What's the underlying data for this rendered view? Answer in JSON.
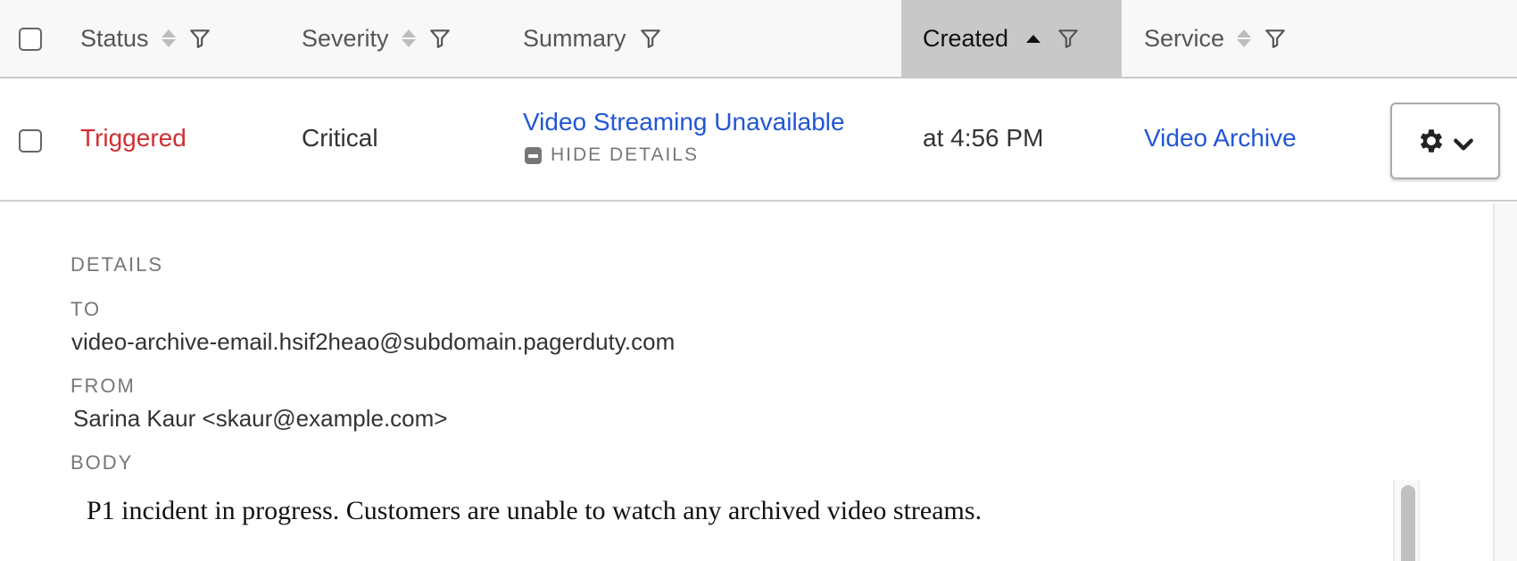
{
  "table": {
    "columns": [
      {
        "label": "Status",
        "sortable": true,
        "filter": true
      },
      {
        "label": "Severity",
        "sortable": true,
        "filter": true
      },
      {
        "label": "Summary",
        "sortable": false,
        "filter": true
      },
      {
        "label": "Created",
        "sortable": true,
        "sorted": "ascending",
        "filter": true
      },
      {
        "label": "Service",
        "sortable": true,
        "filter": true
      }
    ],
    "rows": [
      {
        "status": "Triggered",
        "severity": "Critical",
        "summary": "Video Streaming Unavailable",
        "toggle_details_label": "HIDE DETAILS",
        "created": "at 4:56 PM",
        "service": "Video Archive",
        "actions_icon": "gear-icon",
        "actions_caret_icon": "chevron-down-icon"
      }
    ]
  },
  "details": {
    "heading": "DETAILS",
    "to_label": "TO",
    "to_value": "video-archive-email.hsif2heao@subdomain.pagerduty.com",
    "from_label": "FROM",
    "from_value": "Sarina Kaur <skaur@example.com>",
    "body_label": "BODY",
    "body_value": "P1 incident in progress. Customers are unable to watch any archived video streams."
  },
  "colors": {
    "status_triggered": "#d12f32",
    "link": "#2156d6",
    "sorted_header_bg": "#c8c8c8",
    "header_bg": "#f8f8f8"
  }
}
